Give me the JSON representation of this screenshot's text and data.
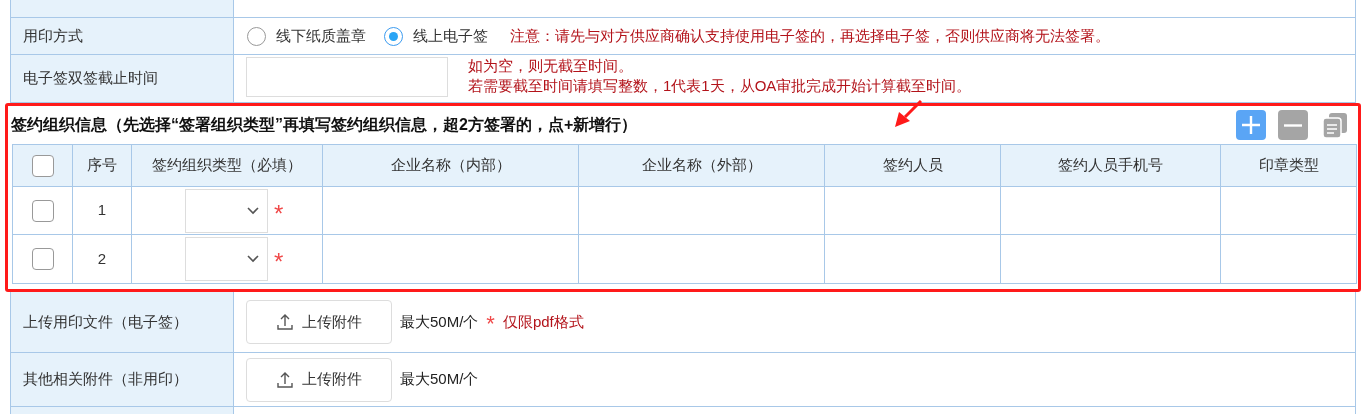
{
  "seal_method": {
    "label": "用印方式",
    "options": [
      {
        "label": "线下纸质盖章",
        "selected": false
      },
      {
        "label": "线上电子签",
        "selected": true
      }
    ],
    "notice": "注意：请先与对方供应商确认支持使用电子签的，再选择电子签，否则供应商将无法签署。"
  },
  "deadline": {
    "label": "电子签双签截止时间",
    "hints": [
      "如为空，则无截至时间。",
      "若需要截至时间请填写整数，1代表1天，从OA审批完成开始计算截至时间。"
    ]
  },
  "signing_section": {
    "title": "签约组织信息（先选择“签署组织类型”再填写签约组织信息，超2方签署的，点+新增行）",
    "select_all_checked": false,
    "columns": [
      "序号",
      "签约组织类型（必填）",
      "企业名称（内部）",
      "企业名称（外部）",
      "签约人员",
      "签约人员手机号",
      "印章类型"
    ],
    "rows": [
      {
        "index": "1",
        "checked": false,
        "required_mark": "*"
      },
      {
        "index": "2",
        "checked": false,
        "required_mark": "*"
      }
    ]
  },
  "uploads": [
    {
      "label": "上传用印文件（电子签）",
      "button": "上传附件",
      "limit": "最大50M/个",
      "required_mark": "*",
      "note": "仅限pdf格式"
    },
    {
      "label": "其他相关附件（非用印）",
      "button": "上传附件",
      "limit": "最大50M/个"
    }
  ]
}
